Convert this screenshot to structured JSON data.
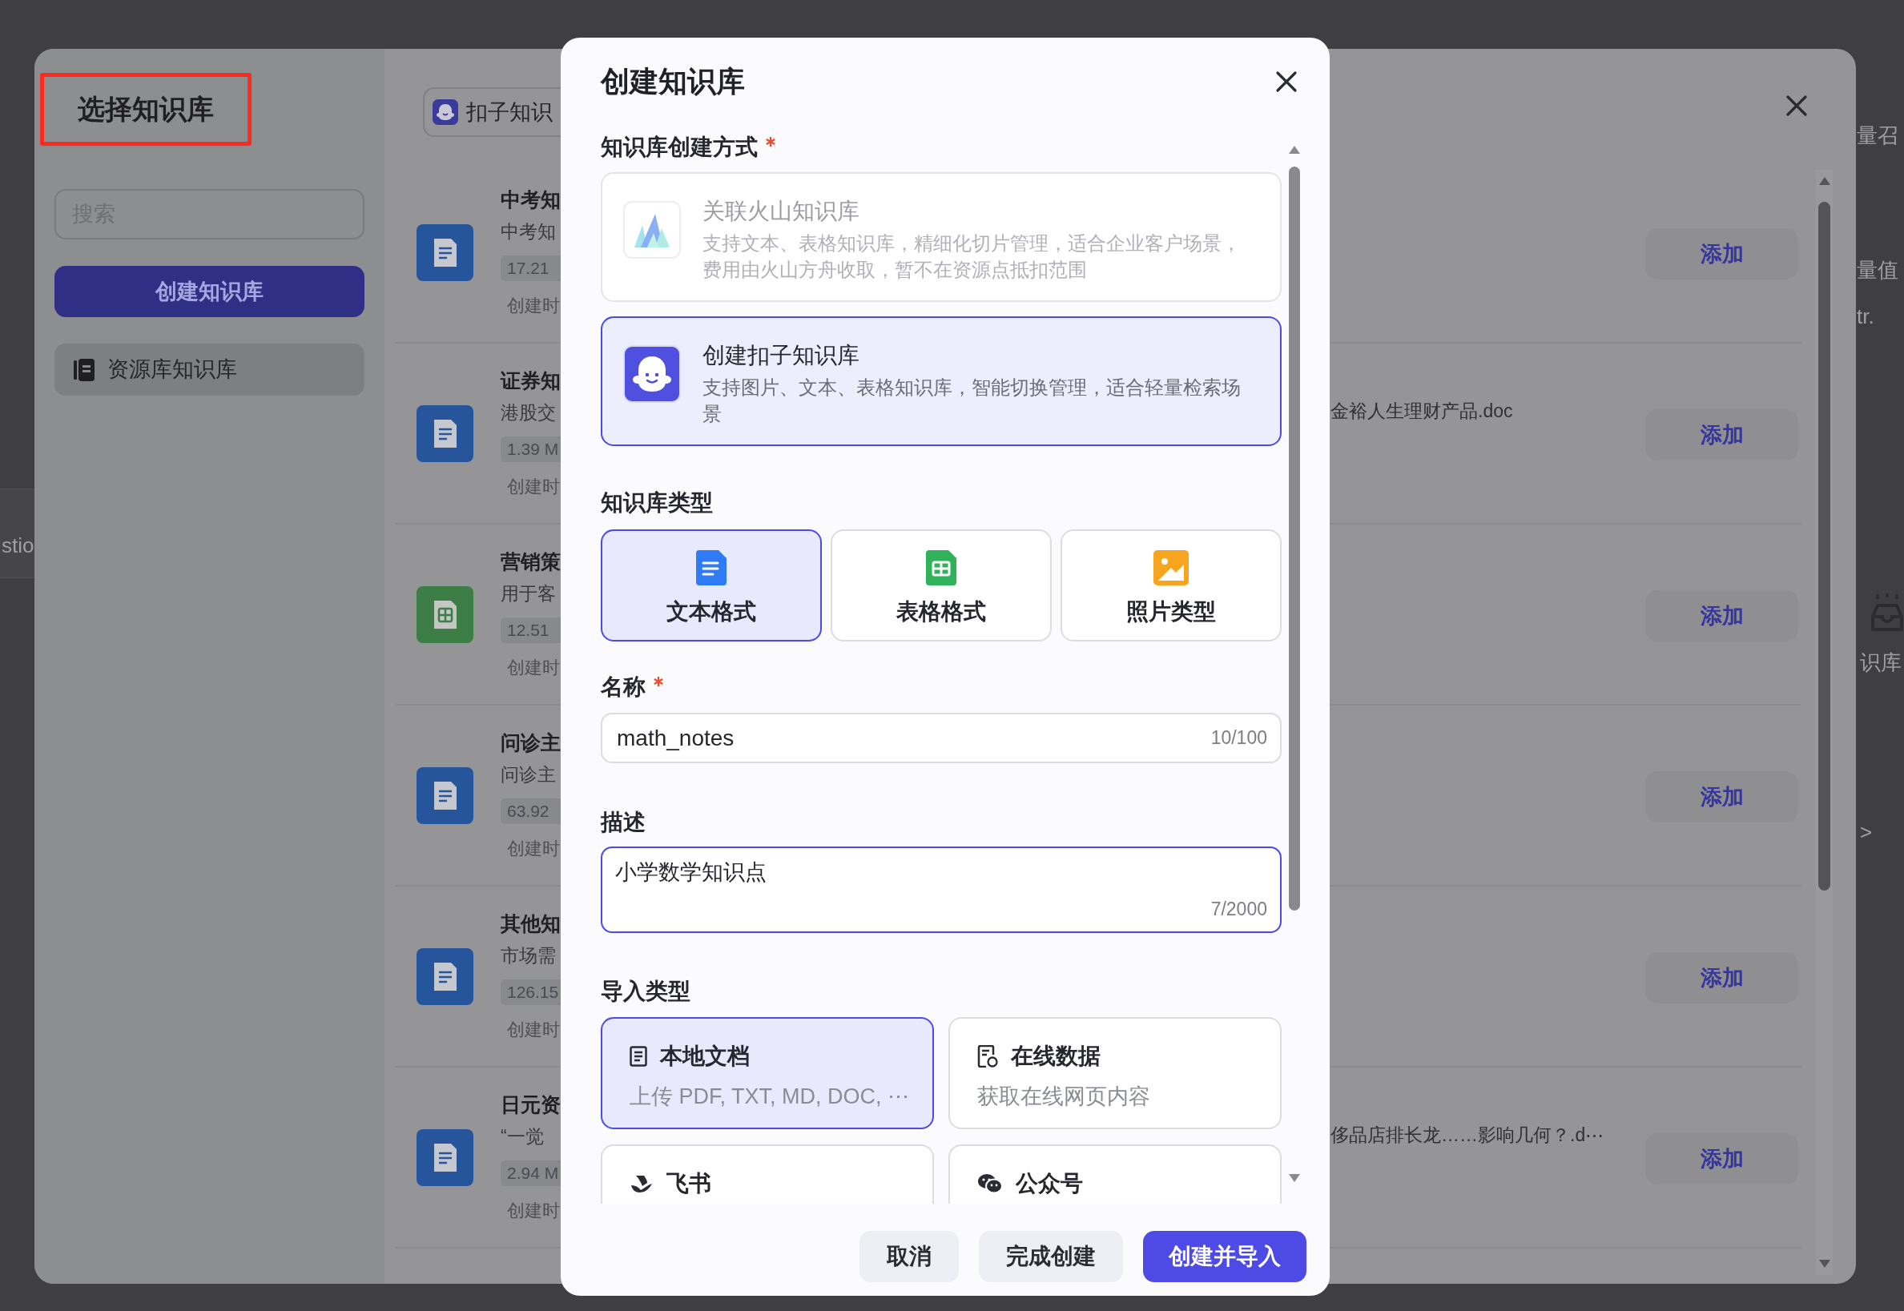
{
  "background_page": {
    "fragments": [
      "stio",
      "量召",
      "量值",
      "tr.",
      "识库",
      ">"
    ]
  },
  "kb_picker": {
    "title": "选择知识库",
    "search": {
      "placeholder": "搜索"
    },
    "create_button": "创建知识库",
    "sidebar_items": [
      {
        "label": "资源库知识库",
        "selected": true
      }
    ],
    "source_chip": "扣子知识",
    "items": [
      {
        "kind": "doc",
        "title": "中考知",
        "description": "中考知",
        "size": "17.21",
        "created": "创建时",
        "add_button": "添加"
      },
      {
        "kind": "doc",
        "title": "证券知",
        "description": "港股交",
        "description_end": "金裕人生理财产品.doc",
        "size": "1.39 M",
        "created": "创建时",
        "add_button": "添加"
      },
      {
        "kind": "table",
        "title": "营销策",
        "description": "用于客",
        "size": "12.51",
        "created": "创建时",
        "add_button": "添加"
      },
      {
        "kind": "doc",
        "title": "问诊主",
        "description": "问诊主",
        "size": "63.92",
        "created": "创建时",
        "add_button": "添加"
      },
      {
        "kind": "doc",
        "title": "其他知",
        "description": "市场需",
        "size": "126.15",
        "created": "创建时",
        "add_button": "添加"
      },
      {
        "kind": "doc",
        "title": "日元资",
        "description": "“一觉",
        "description_end": "侈品店排长龙……影响几何？.d⋯",
        "size": "2.94 M",
        "created": "创建时",
        "add_button": "添加"
      }
    ]
  },
  "dialog": {
    "title": "创建知识库",
    "method": {
      "label": "知识库创建方式",
      "required": true,
      "options": [
        {
          "kind": "volcano",
          "title": "关联火山知识库",
          "description": "支持文本、表格知识库，精细化切片管理，适合企业客户场景，费用由火山方舟收取，暂不在资源点抵扣范围",
          "selected": false,
          "disabled": true
        },
        {
          "kind": "coze",
          "title": "创建扣子知识库",
          "description": "支持图片、文本、表格知识库，智能切换管理，适合轻量检索场景",
          "selected": true,
          "disabled": false
        }
      ]
    },
    "type": {
      "label": "知识库类型",
      "options": [
        {
          "kind": "text",
          "label": "文本格式",
          "selected": true
        },
        {
          "kind": "table",
          "label": "表格格式",
          "selected": false
        },
        {
          "kind": "image",
          "label": "照片类型",
          "selected": false
        }
      ]
    },
    "name": {
      "label": "名称",
      "required": true,
      "value": "math_notes",
      "counter": "10/100"
    },
    "description": {
      "label": "描述",
      "value": "小学数学知识点",
      "counter": "7/2000",
      "focused": true
    },
    "import": {
      "label": "导入类型",
      "options": [
        {
          "kind": "local",
          "title": "本地文档",
          "description": "上传 PDF, TXT, MD, DOC, ⋯",
          "selected": true
        },
        {
          "kind": "online",
          "title": "在线数据",
          "description": "获取在线网页内容",
          "selected": false
        },
        {
          "kind": "feishu",
          "title": "飞书",
          "selected": false
        },
        {
          "kind": "wechat",
          "title": "公众号",
          "selected": false
        }
      ]
    },
    "buttons": [
      {
        "label": "取消",
        "kind": "secondary"
      },
      {
        "label": "完成创建",
        "kind": "secondary"
      },
      {
        "label": "创建并导入",
        "kind": "primary"
      }
    ]
  }
}
